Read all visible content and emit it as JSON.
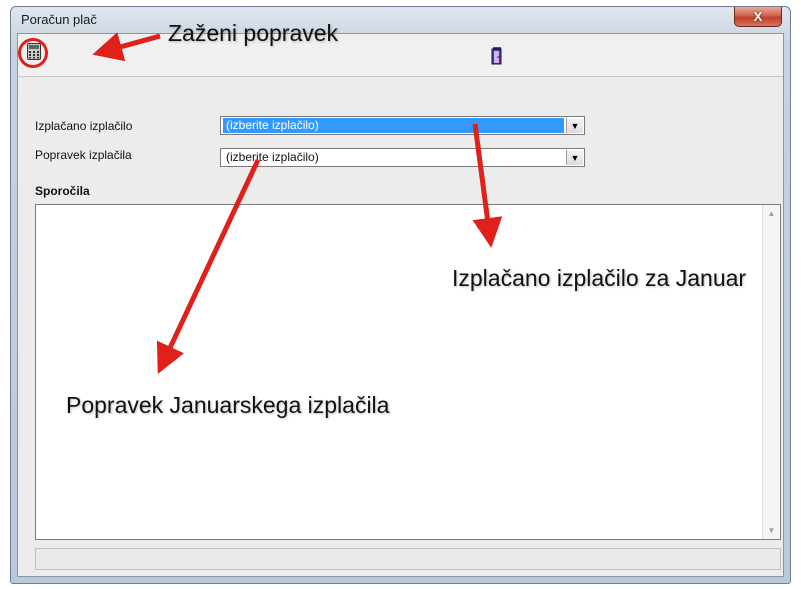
{
  "window": {
    "title": "Poračun plač",
    "close_label": "X"
  },
  "toolbar": {
    "run_icon": "calculator-icon",
    "exit_icon": "exit-door-icon"
  },
  "form": {
    "paid_label": "Izplačano izplačilo",
    "paid_value": "(izberite izplačilo)",
    "fix_label": "Popravek izplačila",
    "fix_value": "(izberite izplačilo)",
    "messages_label": "Sporočila",
    "messages_text": ""
  },
  "annotations": {
    "run": "Zaženi popravek",
    "paid": "Izplačano izplačilo za Januar",
    "fix": "Popravek Januarskega izplačila"
  },
  "colors": {
    "annotation": "#e0201a",
    "selection": "#3399ff"
  }
}
